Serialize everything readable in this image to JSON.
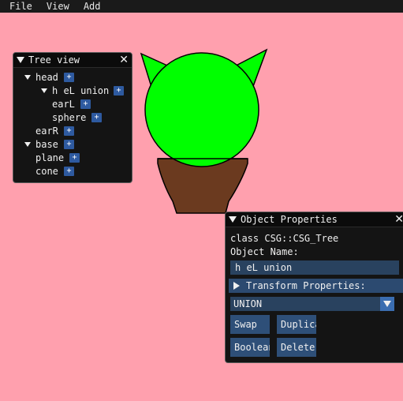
{
  "menubar": {
    "items": [
      "File",
      "View",
      "Add"
    ]
  },
  "colors": {
    "background": "#ffa0ae",
    "sphere": "#00ff00",
    "pot": "#6b3a1f"
  },
  "tree_view": {
    "title": "Tree view",
    "close": "✕",
    "nodes": [
      {
        "label": "head",
        "expanded": true
      },
      {
        "label": "h eL union",
        "expanded": true
      },
      {
        "label": "earL"
      },
      {
        "label": "sphere"
      },
      {
        "label": "earR"
      },
      {
        "label": "base",
        "expanded": true
      },
      {
        "label": "plane"
      },
      {
        "label": "cone"
      }
    ],
    "add": "+"
  },
  "props": {
    "title": "Object Properties",
    "close": "✕",
    "class_line": "class CSG::CSG_Tree",
    "name_label": "Object Name:",
    "name_value": "h eL union",
    "transform_header": "Transform Properties:",
    "operation": "UNION",
    "buttons": {
      "swap": "Swap",
      "duplicate": "Duplicate",
      "boolean": "Boolean",
      "delete": "Delete"
    }
  }
}
